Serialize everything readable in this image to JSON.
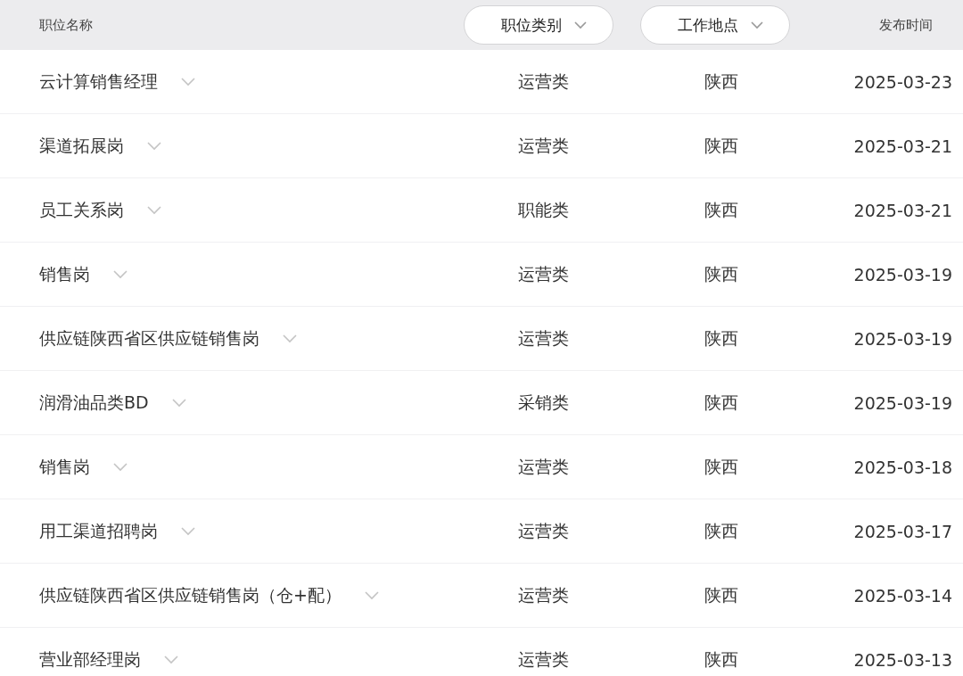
{
  "table": {
    "columns": [
      {
        "label": "职位名称",
        "kind": "text"
      },
      {
        "label": "职位类别",
        "kind": "dropdown"
      },
      {
        "label": "工作地点",
        "kind": "dropdown"
      },
      {
        "label": "发布时间",
        "kind": "text"
      }
    ],
    "rows": [
      {
        "title": "云计算销售经理",
        "expanded": false,
        "category": "运营类",
        "location": "陕西",
        "date": "2025-03-23"
      },
      {
        "title": "渠道拓展岗",
        "expanded": false,
        "category": "运营类",
        "location": "陕西",
        "date": "2025-03-21"
      },
      {
        "title": "员工关系岗",
        "expanded": false,
        "category": "职能类",
        "location": "陕西",
        "date": "2025-03-21"
      },
      {
        "title": "销售岗",
        "expanded": false,
        "category": "运营类",
        "location": "陕西",
        "date": "2025-03-19"
      },
      {
        "title": "供应链陕西省区供应链销售岗",
        "expanded": false,
        "category": "运营类",
        "location": "陕西",
        "date": "2025-03-19"
      },
      {
        "title": "润滑油品类BD",
        "expanded": false,
        "category": "采销类",
        "location": "陕西",
        "date": "2025-03-19"
      },
      {
        "title": "销售岗",
        "expanded": false,
        "category": "运营类",
        "location": "陕西",
        "date": "2025-03-18"
      },
      {
        "title": "用工渠道招聘岗",
        "expanded": false,
        "category": "运营类",
        "location": "陕西",
        "date": "2025-03-17"
      },
      {
        "title": "供应链陕西省区供应链销售岗（仓+配）",
        "expanded": false,
        "category": "运营类",
        "location": "陕西",
        "date": "2025-03-14"
      },
      {
        "title": "营业部经理岗",
        "expanded": false,
        "category": "运营类",
        "location": "陕西",
        "date": "2025-03-13"
      }
    ]
  }
}
